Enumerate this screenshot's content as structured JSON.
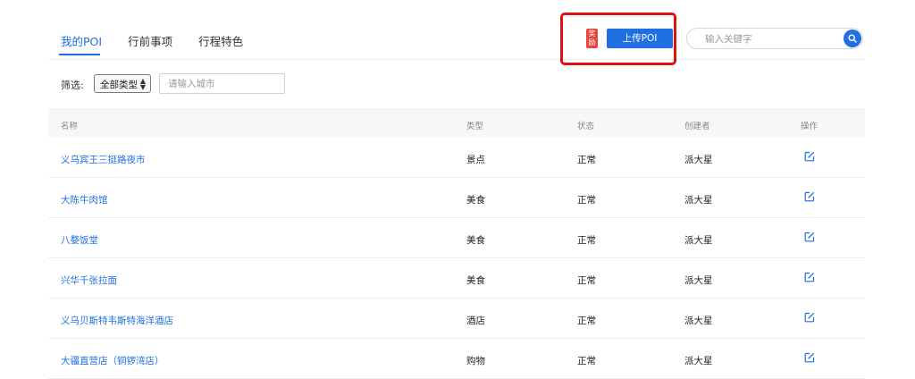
{
  "tabs": [
    {
      "label": "我的POI",
      "active": true
    },
    {
      "label": "行前事项",
      "active": false
    },
    {
      "label": "行程特色",
      "active": false
    }
  ],
  "reward_badge": "奖励",
  "upload_button": "上传POI",
  "search": {
    "placeholder": "输入关键字",
    "value": ""
  },
  "filter": {
    "label": "筛选:",
    "type_selected": "全部类型",
    "city_placeholder": "请输入城市"
  },
  "table": {
    "headers": {
      "name": "名称",
      "type": "类型",
      "status": "状态",
      "creator": "创建者",
      "action": "操作"
    },
    "rows": [
      {
        "name": "义乌宾王三挺路夜市",
        "type": "景点",
        "status": "正常",
        "creator": "派大星"
      },
      {
        "name": "大陈牛肉馆",
        "type": "美食",
        "status": "正常",
        "creator": "派大星"
      },
      {
        "name": "八婺饭堂",
        "type": "美食",
        "status": "正常",
        "creator": "派大星"
      },
      {
        "name": "兴华千张拉面",
        "type": "美食",
        "status": "正常",
        "creator": "派大星"
      },
      {
        "name": "义乌贝斯特韦斯特海洋酒店",
        "type": "酒店",
        "status": "正常",
        "creator": "派大星"
      },
      {
        "name": "大疆直营店（铜锣湾店）",
        "type": "购物",
        "status": "正常",
        "creator": "派大星"
      }
    ]
  },
  "colors": {
    "accent": "#1f6fe0",
    "highlight": "#e01010",
    "reward": "#e8453c"
  },
  "icons": {
    "search": "search-icon",
    "edit": "edit-icon",
    "select_arrows": "up-down-arrows-icon"
  }
}
